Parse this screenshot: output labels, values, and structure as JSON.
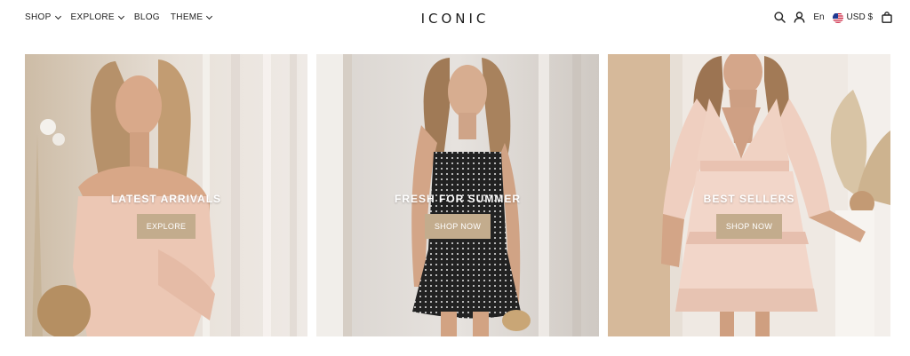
{
  "header": {
    "nav": [
      {
        "label": "SHOP",
        "has_dropdown": true
      },
      {
        "label": "EXPLORE",
        "has_dropdown": true
      },
      {
        "label": "BLOG",
        "has_dropdown": false
      },
      {
        "label": "THEME",
        "has_dropdown": true
      }
    ],
    "logo": "ICONIC",
    "language": "En",
    "currency": "USD $",
    "icons": [
      "search-icon",
      "user-icon",
      "us-flag-icon",
      "shopping-bag-icon"
    ]
  },
  "tiles": [
    {
      "title": "LATEST ARRIVALS",
      "button": "EXPLORE"
    },
    {
      "title": "FRESH FOR SUMMER",
      "button": "SHOP NOW"
    },
    {
      "title": "BEST SELLERS",
      "button": "SHOP NOW"
    }
  ],
  "colors": {
    "button_bg": "#c3ac8d",
    "button_text": "#ffffff",
    "text": "#222222",
    "background": "#ffffff"
  }
}
